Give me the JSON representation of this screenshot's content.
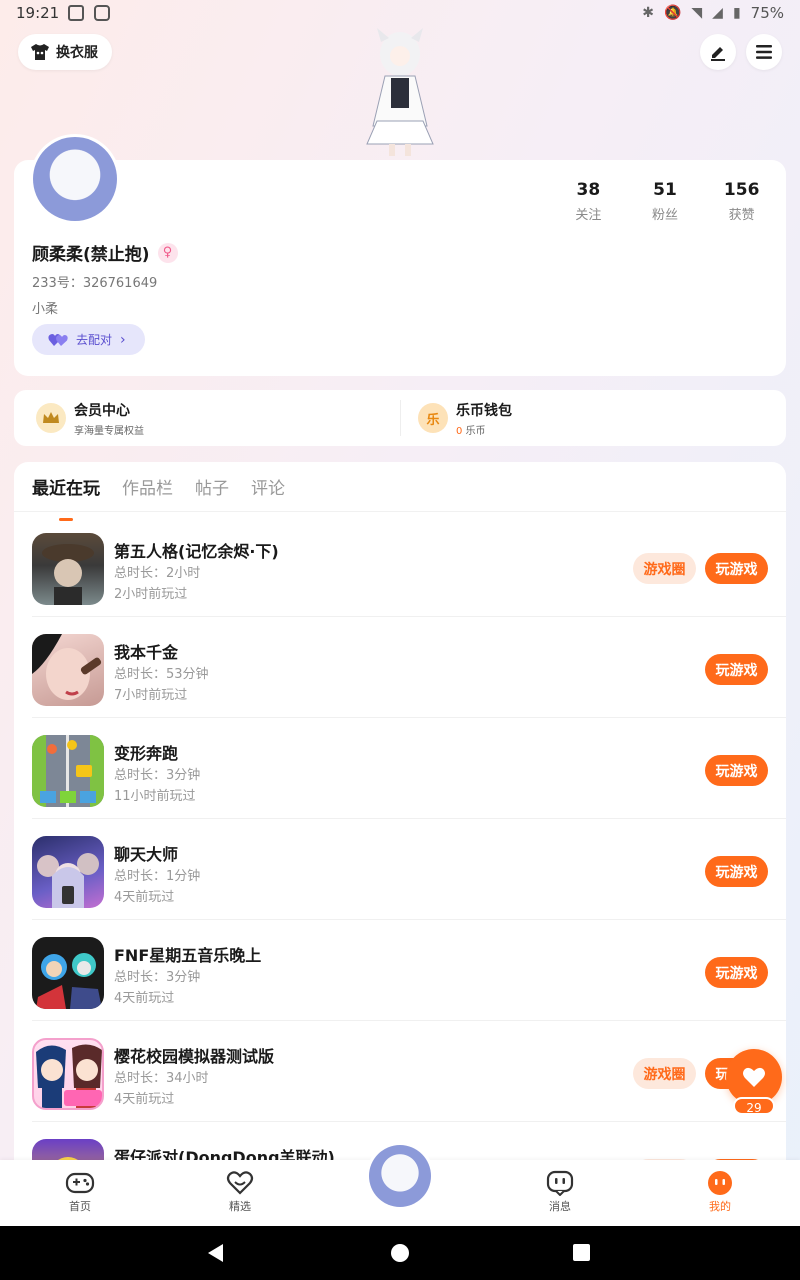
{
  "status_bar": {
    "time": "19:21",
    "battery": "75%"
  },
  "top_bar": {
    "wardrobe_label": "换衣服"
  },
  "profile": {
    "stats": [
      {
        "num": "38",
        "label": "关注"
      },
      {
        "num": "51",
        "label": "粉丝"
      },
      {
        "num": "156",
        "label": "获赞"
      }
    ],
    "username": "顾柔柔(禁止抱)",
    "gender_symbol": "♀",
    "uid": "233号：326761649",
    "bio": "小柔",
    "match_label": "去配对"
  },
  "member": {
    "vip_title": "会员中心",
    "vip_sub": "享海量专属权益",
    "wallet_title": "乐币钱包",
    "wallet_icon_text": "乐",
    "wallet_balance": "0",
    "wallet_unit": "乐币"
  },
  "tabs": [
    "最近在玩",
    "作品栏",
    "帖子",
    "评论"
  ],
  "buttons": {
    "circle": "游戏圈",
    "play": "玩游戏"
  },
  "games": [
    {
      "name": "第五人格(记忆余烬·下)",
      "duration": "总时长：2小时",
      "last": "2小时前玩过",
      "has_circle": true
    },
    {
      "name": "我本千金",
      "duration": "总时长：53分钟",
      "last": "7小时前玩过",
      "has_circle": false
    },
    {
      "name": "变形奔跑",
      "duration": "总时长：3分钟",
      "last": "11小时前玩过",
      "has_circle": false
    },
    {
      "name": "聊天大师",
      "duration": "总时长：1分钟",
      "last": "4天前玩过",
      "has_circle": false
    },
    {
      "name": "FNF星期五音乐晚上",
      "duration": "总时长：3分钟",
      "last": "4天前玩过",
      "has_circle": false
    },
    {
      "name": "樱花校园模拟器测试版",
      "duration": "总时长：34小时",
      "last": "4天前玩过",
      "has_circle": true
    },
    {
      "name": "蛋仔派对(DongDong羊联动)",
      "duration": "",
      "last": "",
      "has_circle": true
    }
  ],
  "float_heart": {
    "count": "29"
  },
  "bottom_nav": [
    {
      "label": "首页"
    },
    {
      "label": "精选"
    },
    {
      "label": "消息"
    },
    {
      "label": "我的"
    }
  ],
  "colors": {
    "accent": "#ff6a1a",
    "match_bg": "#e6e6fb",
    "match_text": "#5a4ecf"
  }
}
